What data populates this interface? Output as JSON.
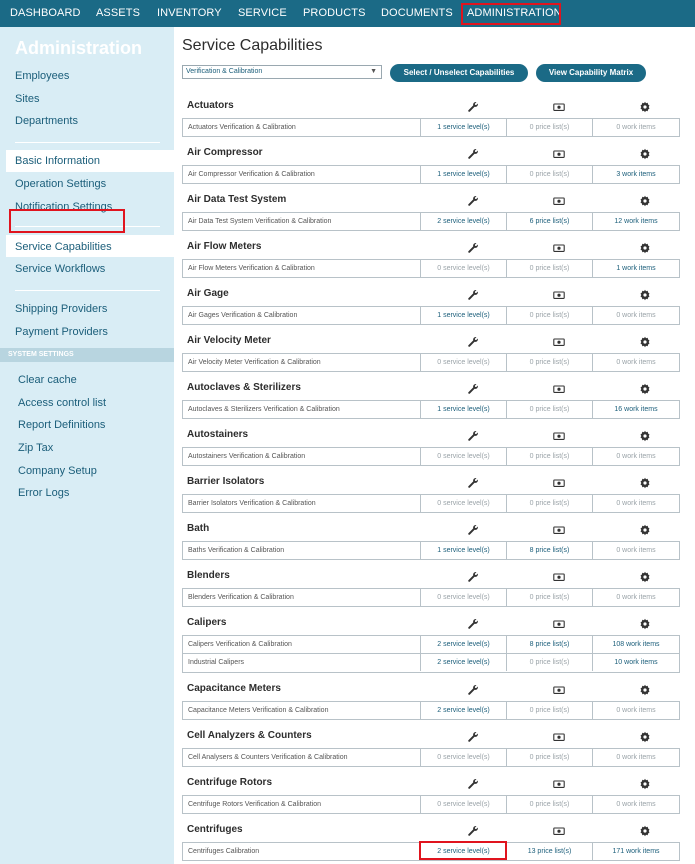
{
  "topnav": {
    "items": [
      "DASHBOARD",
      "ASSETS",
      "INVENTORY",
      "SERVICE",
      "PRODUCTS",
      "DOCUMENTS",
      "ADMINISTRATION"
    ]
  },
  "sidebar": {
    "title": "Administration",
    "group1": [
      "Employees",
      "Sites",
      "Departments"
    ],
    "group2": [
      "Basic Information",
      "Operation Settings",
      "Notification Settings"
    ],
    "group3": [
      "Service Capabilities",
      "Service Workflows"
    ],
    "group4": [
      "Shipping Providers",
      "Payment Providers"
    ],
    "system_header": "SYSTEM SETTINGS",
    "system": [
      "Clear cache",
      "Access control list",
      "Report Definitions",
      "Zip Tax",
      "Company Setup",
      "Error Logs"
    ]
  },
  "main": {
    "title": "Service Capabilities",
    "dropdown_value": "Verification & Calibration",
    "select_button": "Select / Unselect Capabilities",
    "matrix_button": "View Capability Matrix",
    "sections": [
      {
        "name": "Actuators",
        "rows": [
          [
            "Actuators Verification & Calibration",
            "1 service level(s)",
            "0 price list(s)",
            "0 work items"
          ]
        ]
      },
      {
        "name": "Air Compressor",
        "rows": [
          [
            "Air Compressor Verification & Calibration",
            "1 service level(s)",
            "0 price list(s)",
            "3 work items"
          ]
        ]
      },
      {
        "name": "Air Data Test System",
        "rows": [
          [
            "Air Data Test System Verification & Calibration",
            "2 service level(s)",
            "6 price list(s)",
            "12 work items"
          ]
        ]
      },
      {
        "name": "Air Flow Meters",
        "rows": [
          [
            "Air Flow Meters Verification & Calibration",
            "0 service level(s)",
            "0 price list(s)",
            "1 work items"
          ]
        ]
      },
      {
        "name": "Air Gage",
        "rows": [
          [
            "Air Gages Verification & Calibration",
            "1 service level(s)",
            "0 price list(s)",
            "0 work items"
          ]
        ]
      },
      {
        "name": "Air Velocity Meter",
        "rows": [
          [
            "Air Velocity Meter Verification & Calibration",
            "0 service level(s)",
            "0 price list(s)",
            "0 work items"
          ]
        ]
      },
      {
        "name": "Autoclaves & Sterilizers",
        "rows": [
          [
            "Autoclaves & Sterilizers Verification & Calibration",
            "1 service level(s)",
            "0 price list(s)",
            "16 work items"
          ]
        ]
      },
      {
        "name": "Autostainers",
        "rows": [
          [
            "Autostainers Verification & Calibration",
            "0 service level(s)",
            "0 price list(s)",
            "0 work items"
          ]
        ]
      },
      {
        "name": "Barrier Isolators",
        "rows": [
          [
            "Barrier Isolators Verification & Calibration",
            "0 service level(s)",
            "0 price list(s)",
            "0 work items"
          ]
        ]
      },
      {
        "name": "Bath",
        "rows": [
          [
            "Baths Verification & Calibration",
            "1 service level(s)",
            "8 price list(s)",
            "0 work items"
          ]
        ]
      },
      {
        "name": "Blenders",
        "rows": [
          [
            "Blenders Verification & Calibration",
            "0 service level(s)",
            "0 price list(s)",
            "0 work items"
          ]
        ]
      },
      {
        "name": "Calipers",
        "rows": [
          [
            "Calipers Verification & Calibration",
            "2 service level(s)",
            "8 price list(s)",
            "108 work items"
          ],
          [
            "Industrial Calipers",
            "2 service level(s)",
            "0 price list(s)",
            "10 work items"
          ]
        ]
      },
      {
        "name": "Capacitance Meters",
        "rows": [
          [
            "Capacitance Meters Verification & Calibration",
            "2 service level(s)",
            "0 price list(s)",
            "0 work items"
          ]
        ]
      },
      {
        "name": "Cell Analyzers & Counters",
        "rows": [
          [
            "Cell Analysers & Counters Verification & Calibration",
            "0 service level(s)",
            "0 price list(s)",
            "0 work items"
          ]
        ]
      },
      {
        "name": "Centrifuge Rotors",
        "rows": [
          [
            "Centrifuge Rotors Verification & Calibration",
            "0 service level(s)",
            "0 price list(s)",
            "0 work items"
          ]
        ]
      },
      {
        "name": "Centrifuges",
        "rows": [
          [
            "Centrifuges Calibration",
            "2 service level(s)",
            "13 price list(s)",
            "171 work items"
          ]
        ]
      }
    ]
  },
  "icons": {
    "col1": "wrench-icon",
    "col2": "money-icon",
    "col3": "gear-icon"
  },
  "colors": {
    "nav": "#1b6a86",
    "sidebar": "#d9edf5",
    "link": "#1b5e7a",
    "highlight": "#e0141e"
  }
}
